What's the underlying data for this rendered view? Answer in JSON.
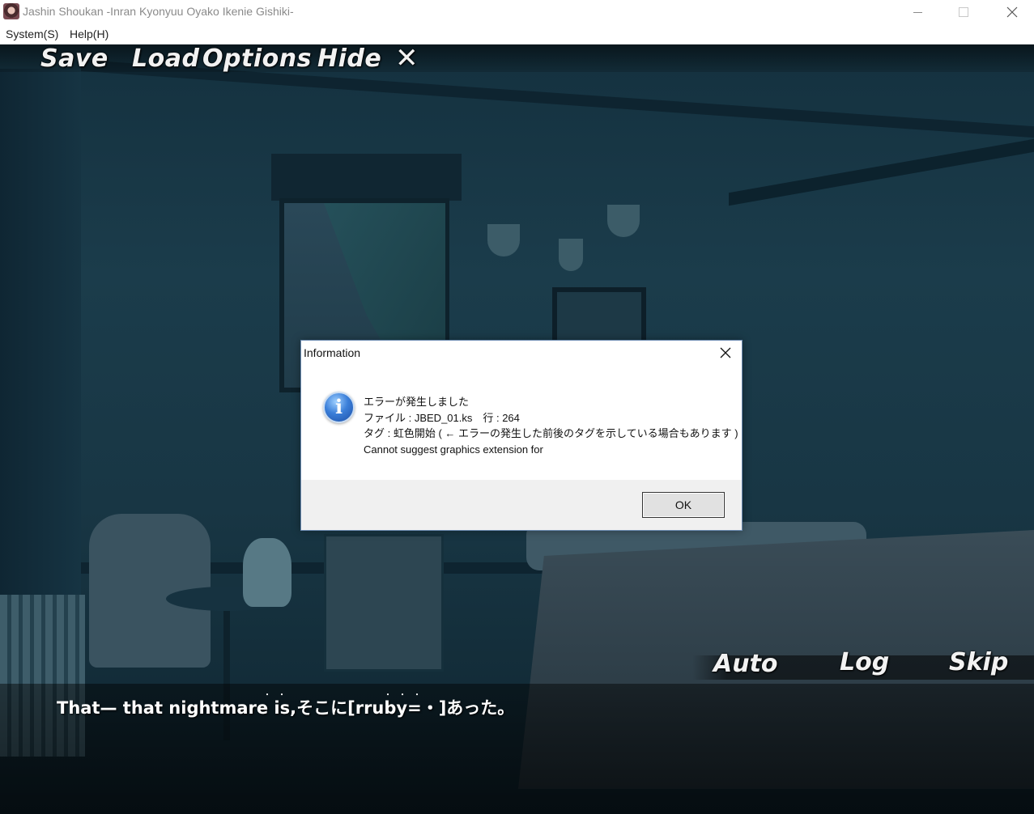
{
  "window": {
    "title": "Jashin Shoukan -Inran Kyonyuu Oyako Ikenie Gishiki-",
    "icons": {
      "app": "app-icon",
      "minimize": "minimize-icon",
      "maximize": "maximize-icon",
      "close": "close-icon"
    }
  },
  "menubar": {
    "system": "System(S)",
    "help": "Help(H)"
  },
  "game_menu": {
    "save": "Save",
    "load": "Load",
    "options": "Options",
    "hide": "Hide",
    "close_glyph": "✕"
  },
  "message_controls": {
    "auto": "Auto",
    "log": "Log",
    "skip": "Skip"
  },
  "dialogue": {
    "ruby_dots_1": "・・",
    "ruby_dots_2": "・・・",
    "text": "That— that nightmare is,そこに[rruby=・]あった。"
  },
  "dialog": {
    "title": "Information",
    "icon": "info-icon",
    "icon_glyph": "i",
    "lines": [
      "エラーが発生しました",
      "ファイル : JBED_01.ks　行 : 264",
      "タグ : 虹色開始 ( ← エラーの発生した前後のタグを示している場合もあります )",
      "Cannot suggest graphics extension for"
    ],
    "ok": "OK"
  },
  "colors": {
    "scene_dark": "#14313f",
    "dialog_border": "#6b8ab0",
    "footer": "#f0f0f0"
  }
}
